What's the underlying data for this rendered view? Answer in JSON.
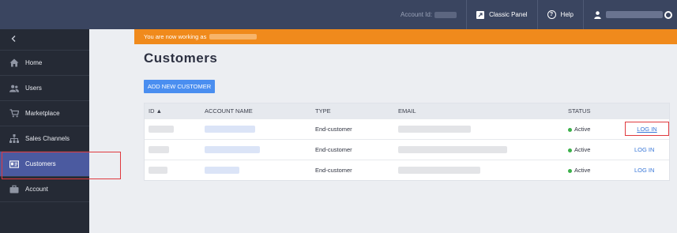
{
  "topbar": {
    "account_id_label": "Account Id:",
    "classic_panel_label": "Classic Panel",
    "help_label": "Help"
  },
  "sidebar": {
    "items": [
      {
        "label": "Home",
        "icon": "home-icon"
      },
      {
        "label": "Users",
        "icon": "users-icon"
      },
      {
        "label": "Marketplace",
        "icon": "cart-icon"
      },
      {
        "label": "Sales Channels",
        "icon": "hierarchy-icon"
      },
      {
        "label": "Customers",
        "icon": "id-card-icon",
        "active": true
      },
      {
        "label": "Account",
        "icon": "briefcase-icon"
      }
    ]
  },
  "banner": {
    "text": "You are now working as"
  },
  "main": {
    "title": "Customers",
    "add_button_label": "ADD NEW CUSTOMER"
  },
  "table": {
    "columns": {
      "id": "ID ▲",
      "account_name": "ACCOUNT NAME",
      "type": "TYPE",
      "email": "EMAIL",
      "status": "STATUS"
    },
    "rows": [
      {
        "type": "End-customer",
        "status": "Active",
        "action": "LOG IN"
      },
      {
        "type": "End-customer",
        "status": "Active",
        "action": "LOG IN"
      },
      {
        "type": "End-customer",
        "status": "Active",
        "action": "LOG IN"
      }
    ]
  },
  "colors": {
    "topbar": "#3a4560",
    "sidebar": "#252a35",
    "active_nav": "#4b5aa0",
    "banner": "#f08a1c",
    "primary_button": "#4a8ef0",
    "highlight": "#e0393e",
    "status_active": "#3cb04a"
  }
}
